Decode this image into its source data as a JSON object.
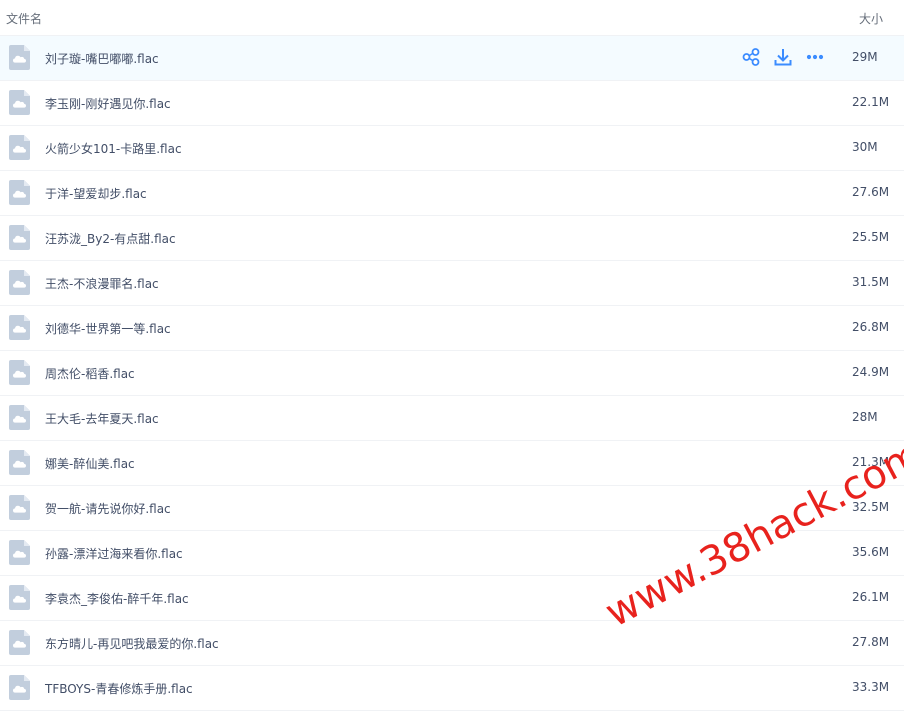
{
  "header": {
    "name_label": "文件名",
    "size_label": "大小"
  },
  "accent_color": "#3b8cff",
  "files": [
    {
      "name": "刘子璇-嘴巴嘟嘟.flac",
      "size": "29M",
      "hover": true
    },
    {
      "name": "李玉刚-刚好遇见你.flac",
      "size": "22.1M"
    },
    {
      "name": "火箭少女101-卡路里.flac",
      "size": "30M"
    },
    {
      "name": "于洋-望爱却步.flac",
      "size": "27.6M"
    },
    {
      "name": "汪苏泷_By2-有点甜.flac",
      "size": "25.5M"
    },
    {
      "name": "王杰-不浪漫罪名.flac",
      "size": "31.5M"
    },
    {
      "name": "刘德华-世界第一等.flac",
      "size": "26.8M"
    },
    {
      "name": "周杰伦-稻香.flac",
      "size": "24.9M"
    },
    {
      "name": "王大毛-去年夏天.flac",
      "size": "28M"
    },
    {
      "name": "娜美-醉仙美.flac",
      "size": "21.3M"
    },
    {
      "name": "贺一航-请先说你好.flac",
      "size": "32.5M"
    },
    {
      "name": "孙露-漂洋过海来看你.flac",
      "size": "35.6M"
    },
    {
      "name": "李袁杰_李俊佑-醉千年.flac",
      "size": "26.1M"
    },
    {
      "name": "东方晴儿-再见吧我最爱的你.flac",
      "size": "27.8M"
    },
    {
      "name": "TFBOYS-青春修炼手册.flac",
      "size": "33.3M"
    }
  ],
  "row_icons": [
    "file-cloud-icon"
  ],
  "hover_actions": [
    {
      "icon": "share-icon"
    },
    {
      "icon": "download-icon"
    },
    {
      "icon": "more-icon"
    }
  ],
  "watermark": "www.38hack.com"
}
